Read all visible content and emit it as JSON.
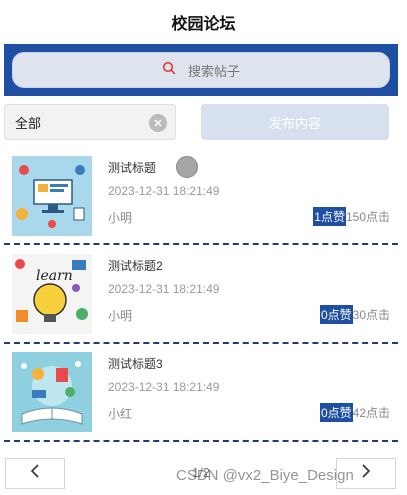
{
  "header": {
    "title": "校园论坛"
  },
  "search": {
    "placeholder": "搜索帖子",
    "icon": "search-icon"
  },
  "filter": {
    "selected": "全部",
    "clear_icon": "close-icon"
  },
  "publish_button": {
    "label": "发布内容"
  },
  "posts": [
    {
      "title": "测试标题",
      "datetime": "2023-12-31 18:21:49",
      "author": "小明",
      "likes": "1点赞",
      "views": "150点击"
    },
    {
      "title": "测试标题2",
      "datetime": "2023-12-31 18:21:49",
      "author": "小明",
      "likes": "0点赞",
      "views": "30点击"
    },
    {
      "title": "测试标题3",
      "datetime": "2023-12-31 18:21:49",
      "author": "小红",
      "likes": "0点赞",
      "views": "42点击"
    }
  ],
  "pagination": {
    "page_text": "1/2",
    "prev_icon": "chevron-left-icon",
    "next_icon": "chevron-right-icon"
  },
  "watermark": "CSDN @vx2_Biye_Design",
  "colors": {
    "accent": "#1f4fa3",
    "separator": "#1b3f6e",
    "publish_bg": "#d6e0ee"
  }
}
